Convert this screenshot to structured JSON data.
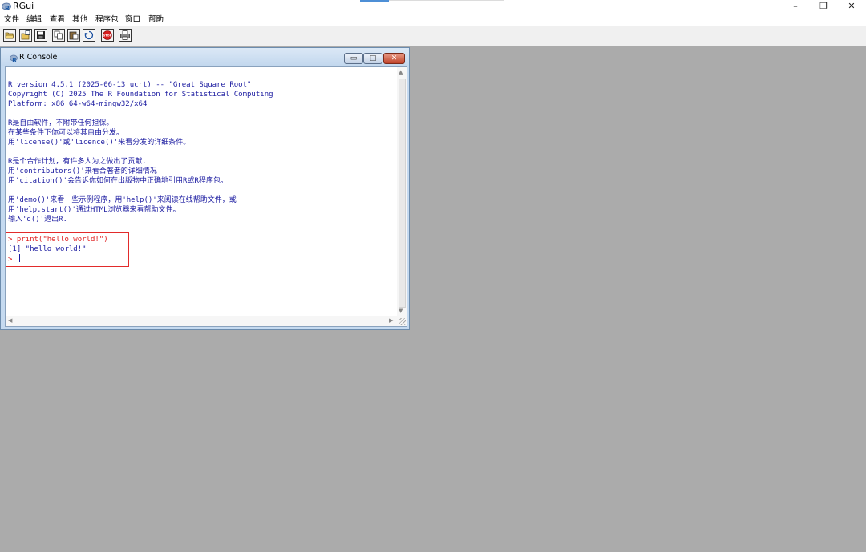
{
  "app": {
    "title": "RGui"
  },
  "window_controls": {
    "minimize": "–",
    "restore": "❐",
    "close": "✕"
  },
  "menu": [
    {
      "label": "文件"
    },
    {
      "label": "编辑"
    },
    {
      "label": "查看"
    },
    {
      "label": "其他"
    },
    {
      "label": "程序包"
    },
    {
      "label": "窗口"
    },
    {
      "label": "帮助"
    }
  ],
  "toolbar": {
    "icons": [
      "open-script-icon",
      "load-workspace-icon",
      "save-workspace-icon",
      "copy-icon",
      "paste-icon",
      "copy-paste-icon",
      "stop-icon",
      "print-icon"
    ],
    "stop_label": "STOP"
  },
  "console": {
    "title": "R Console",
    "controls": {
      "minimize": "▭",
      "maximize": "□",
      "close": "✕"
    },
    "lines": [
      {
        "text": "R version 4.5.1 (2025-06-13 ucrt) -- \"Great Square Root\""
      },
      {
        "text": "Copyright (C) 2025 The R Foundation for Statistical Computing"
      },
      {
        "text": "Platform: x86_64-w64-mingw32/x64"
      },
      {
        "text": "R是自由软件，不附带任何担保。"
      },
      {
        "text": "在某些条件下你可以将其自由分发。"
      },
      {
        "text": "用'license()'或'licence()'来看分发的详细条件。"
      },
      {
        "text": "R是个合作计划，有许多人为之做出了贡献."
      },
      {
        "text": "用'contributors()'来看合著者的详细情况"
      },
      {
        "text": "用'citation()'会告诉你如何在出版物中正确地引用R或R程序包。"
      },
      {
        "text": "用'demo()'来看一些示例程序，用'help()'来阅读在线帮助文件，或"
      },
      {
        "text": "用'help.start()'通过HTML浏览器来看帮助文件。"
      },
      {
        "text": "输入'q()'退出R."
      },
      {
        "text": "> print(\"hello world!\")"
      },
      {
        "text": "[1] \"hello world!\""
      },
      {
        "text": "> "
      }
    ]
  },
  "colors": {
    "console_text": "#1a1aa0",
    "command_text": "#e02020",
    "highlight_border": "#e22b2b",
    "mdi_background": "#ababab"
  }
}
